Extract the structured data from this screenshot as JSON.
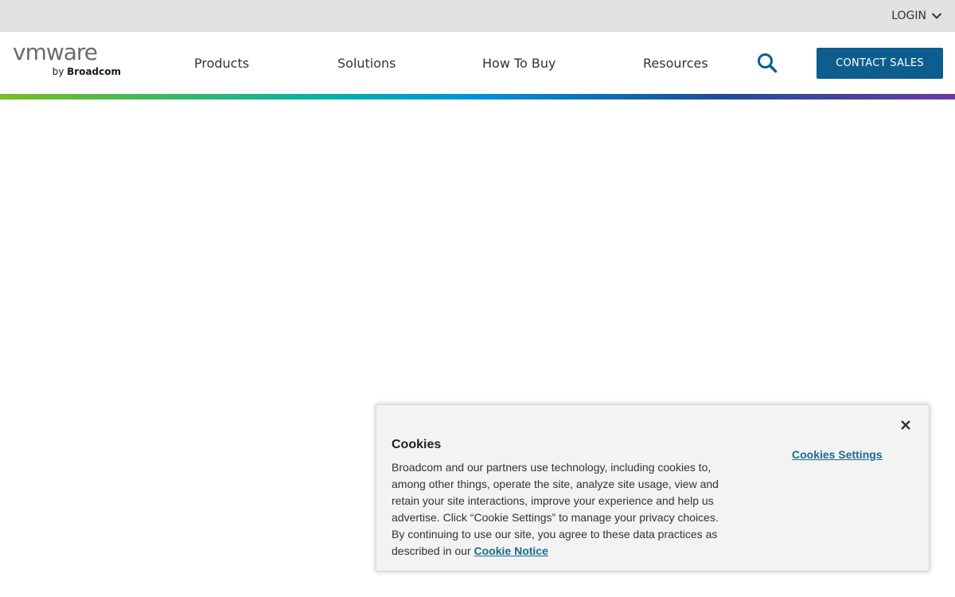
{
  "utility_bar": {
    "login_label": "LOGIN",
    "login_icon": "chevron-down-icon"
  },
  "header": {
    "logo": {
      "wordmark": "vmware",
      "byline_prefix": "by",
      "byline_brand": "Broadcom"
    },
    "nav": [
      {
        "label": "Products"
      },
      {
        "label": "Solutions"
      },
      {
        "label": "How To Buy"
      },
      {
        "label": "Resources"
      }
    ],
    "search_icon": "search-icon",
    "contact_label": "CONTACT SALES"
  },
  "cookie_banner": {
    "title": "Cookies",
    "body": "Broadcom and our partners use technology, including cookies to, among other things, operate the site, analyze site usage, view and retain your site interactions, improve your experience and help us advertise. Click “Cookie Settings” to manage your privacy choices. By continuing to use our site, you agree to these data practices as described in our",
    "notice_link": "Cookie Notice",
    "settings_link": "Cookies Settings",
    "close_icon": "close-icon"
  },
  "colors": {
    "utility_bar_bg": "#e2e2e2",
    "brand_blue": "#0d5e8e",
    "link_blue": "#1b6a8e",
    "stripe_start": "#78be20",
    "stripe_end": "#6a3b9c",
    "cookie_bg": "#f3f3f3"
  }
}
